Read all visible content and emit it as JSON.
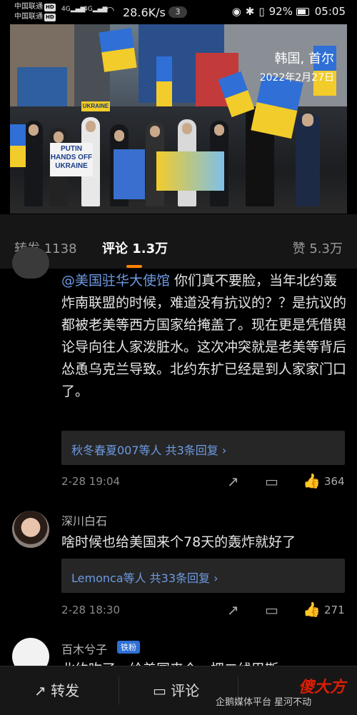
{
  "status_bar": {
    "carrier1": "中国联通",
    "carrier2": "中国联通",
    "hd": "HD",
    "net1": "4G",
    "net2": "4G",
    "speed": "28.6K/s",
    "notif_count": "3",
    "battery": "92%",
    "time": "05:05"
  },
  "photo": {
    "location": "韩国, 首尔",
    "date": "2022年2月27日",
    "sign_text": "PUTIN\nHANDS OFF\nUKRAINE",
    "sign_small": "UKRAINE"
  },
  "tabs": {
    "repost_label": "转发",
    "repost_count": "1138",
    "comment_label": "评论",
    "comment_count": "1.3万",
    "like_label": "赞",
    "like_count": "5.3万"
  },
  "comments": [
    {
      "mention": "@美国驻华大使馆",
      "text": " 你们真不要脸，当年北约轰炸南联盟的时候，难道没有抗议的？？是抗议的都被老美等西方国家给掩盖了。现在更是凭借舆论导向往人家泼脏水。这次冲突就是老美等背后怂恿乌克兰导致。北约东扩已经是到人家家门口了。",
      "replies": "秋冬春夏007等人  共3条回复 ›",
      "time": "2-28 19:04",
      "likes": "364"
    },
    {
      "user": "深川白石",
      "text": "啥时候也给美国来个78天的轰炸就好了",
      "replies": "Lemonca等人  共33条回复 ›",
      "time": "2-28 18:30",
      "likes": "271"
    },
    {
      "user": "百木兮子",
      "badge": "铁粉",
      "text": "北约吹了…给美国来个…把二线巴斯…"
    }
  ],
  "bottom_bar": {
    "repost": "转发",
    "comment": "评论"
  },
  "watermark": {
    "text": "企鹅媒体平台 星河不动",
    "logo": "傻大方"
  },
  "colors": {
    "accent": "#ff8200",
    "link": "#6d9be3",
    "badge": "#2d6fd6"
  }
}
